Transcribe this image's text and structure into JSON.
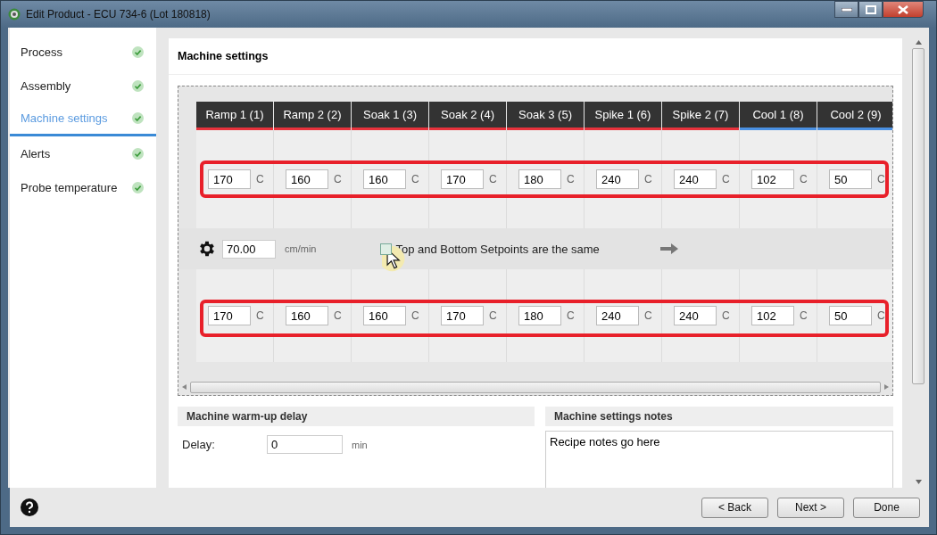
{
  "window": {
    "title": "Edit Product - ECU 734-6 (Lot 180818)"
  },
  "sidebar": {
    "items": [
      {
        "label": "Process",
        "selected": false,
        "complete": true
      },
      {
        "label": "Assembly",
        "selected": false,
        "complete": true
      },
      {
        "label": "Machine settings",
        "selected": true,
        "complete": true
      },
      {
        "label": "Alerts",
        "selected": false,
        "complete": true
      },
      {
        "label": "Probe temperature",
        "selected": false,
        "complete": true
      }
    ]
  },
  "page": {
    "title": "Machine settings"
  },
  "zones": [
    {
      "name": "Ramp 1 (1)",
      "color": "#e8323c",
      "top": {
        "value": "170",
        "unit": "C"
      },
      "bottom": {
        "value": "170",
        "unit": "C"
      }
    },
    {
      "name": "Ramp 2 (2)",
      "color": "#e8323c",
      "top": {
        "value": "160",
        "unit": "C"
      },
      "bottom": {
        "value": "160",
        "unit": "C"
      }
    },
    {
      "name": "Soak 1 (3)",
      "color": "#e8323c",
      "top": {
        "value": "160",
        "unit": "C"
      },
      "bottom": {
        "value": "160",
        "unit": "C"
      }
    },
    {
      "name": "Soak 2 (4)",
      "color": "#e8323c",
      "top": {
        "value": "170",
        "unit": "C"
      },
      "bottom": {
        "value": "170",
        "unit": "C"
      }
    },
    {
      "name": "Soak 3 (5)",
      "color": "#e8323c",
      "top": {
        "value": "180",
        "unit": "C"
      },
      "bottom": {
        "value": "180",
        "unit": "C"
      }
    },
    {
      "name": "Spike 1 (6)",
      "color": "#e8323c",
      "top": {
        "value": "240",
        "unit": "C"
      },
      "bottom": {
        "value": "240",
        "unit": "C"
      }
    },
    {
      "name": "Spike 2 (7)",
      "color": "#e8323c",
      "top": {
        "value": "240",
        "unit": "C"
      },
      "bottom": {
        "value": "240",
        "unit": "C"
      }
    },
    {
      "name": "Cool 1 (8)",
      "color": "#4a90e2",
      "top": {
        "value": "102",
        "unit": "C"
      },
      "bottom": {
        "value": "102",
        "unit": "C"
      }
    },
    {
      "name": "Cool 2 (9)",
      "color": "#4a90e2",
      "top": {
        "value": "50",
        "unit": "C"
      },
      "bottom": {
        "value": "50",
        "unit": "C"
      }
    }
  ],
  "conveyor": {
    "speed": "70.00",
    "unit": "cm/min"
  },
  "same_setpoints": {
    "label": "Top and Bottom Setpoints are the same",
    "checked": false
  },
  "warmup": {
    "title": "Machine warm-up delay",
    "label": "Delay:",
    "value": "0",
    "unit": "min"
  },
  "notes": {
    "title": "Machine settings notes",
    "value": "Recipe notes go here"
  },
  "buttons": [
    "< Back",
    "Next >",
    "Done"
  ]
}
